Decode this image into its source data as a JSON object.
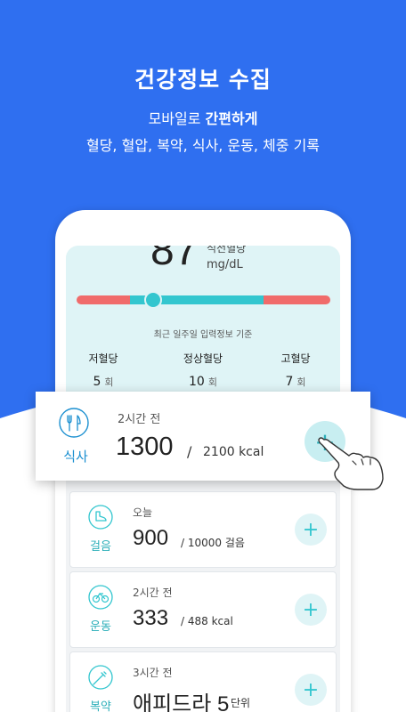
{
  "header": {
    "title": "건강정보 수집",
    "subtitle_prefix": "모바일로 ",
    "subtitle_bold": "간편하게",
    "description": "혈당, 혈압, 복약, 식사, 운동, 체중 기록"
  },
  "glucose": {
    "value": "87",
    "label": "식전혈당",
    "unit": "mg/dL",
    "basis": "최근 일주일 입력정보 기준",
    "stats": [
      {
        "label": "저혈당",
        "value": "5",
        "unit": "회"
      },
      {
        "label": "정상혈당",
        "value": "10",
        "unit": "회"
      },
      {
        "label": "고혈당",
        "value": "7",
        "unit": "회"
      }
    ]
  },
  "meal": {
    "category": "식사",
    "time": "2시간 전",
    "value": "1300",
    "slash": "/",
    "goal": "2100 kcal",
    "add": "+"
  },
  "walk": {
    "category": "걸음",
    "time": "오늘",
    "value": "900",
    "goal": "/  10000 걸음",
    "add": "+"
  },
  "exercise": {
    "category": "운동",
    "time": "2시간 전",
    "value": "333",
    "goal": "/  488 kcal",
    "add": "+"
  },
  "medication": {
    "category": "복약",
    "time": "3시간 전",
    "value": "애피드라 5",
    "goal": "단위",
    "add": "+"
  },
  "colors": {
    "brand_blue": "#2f6ff0",
    "teal": "#33c6cf",
    "alert_red": "#f06b6b",
    "meal_blue": "#1a8fd0"
  },
  "icons": [
    "utensils-icon",
    "shoe-icon",
    "bicycle-icon",
    "syringe-icon",
    "plus-icon",
    "hand-pointer-icon"
  ]
}
